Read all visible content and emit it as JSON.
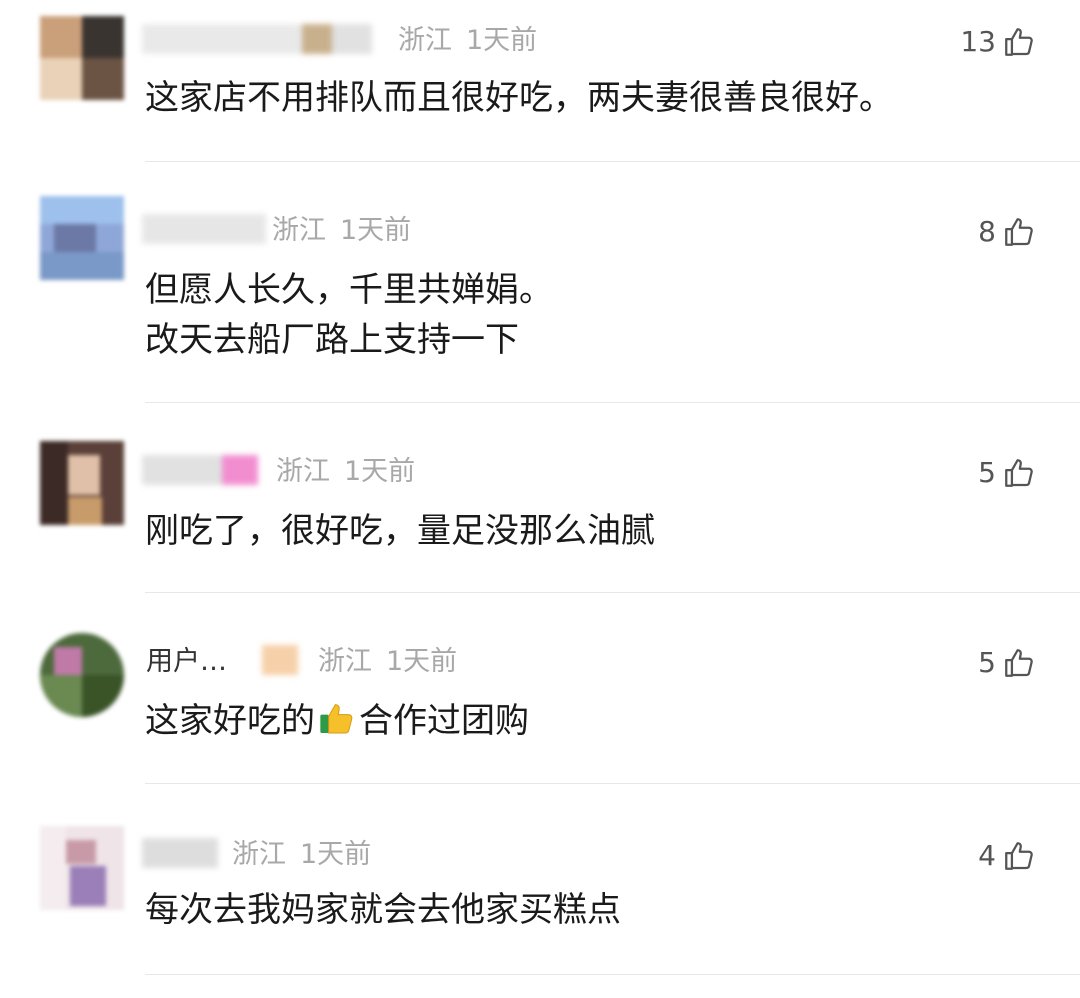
{
  "comments": [
    {
      "location": "浙江",
      "time": "1天前",
      "likes": "13",
      "lines": [
        "这家店不用排队而且很好吃，两夫妻很善良很好。"
      ]
    },
    {
      "location": "浙江",
      "time": "1天前",
      "likes": "8",
      "lines": [
        "但愿人长久，千里共婵娟。",
        "改天去船厂路上支持一下"
      ]
    },
    {
      "location": "浙江",
      "time": "1天前",
      "likes": "5",
      "lines": [
        "刚吃了，很好吃，量足没那么油腻"
      ]
    },
    {
      "name_visible": "用户…",
      "location": "浙江",
      "time": "1天前",
      "likes": "5",
      "text_before": "这家好吃的",
      "text_emoji": "thumbs-up-emoji",
      "text_after": "合作过团购"
    },
    {
      "location": "浙江",
      "time": "1天前",
      "likes": "4",
      "lines": [
        "每次去我妈家就会去他家买糕点"
      ]
    }
  ],
  "icons": {
    "like": "thumbs-up-outline-icon"
  },
  "colors": {
    "meta_gray": "#a8a8a8",
    "text": "#1a1a1a",
    "divider": "#e8e8e8"
  }
}
